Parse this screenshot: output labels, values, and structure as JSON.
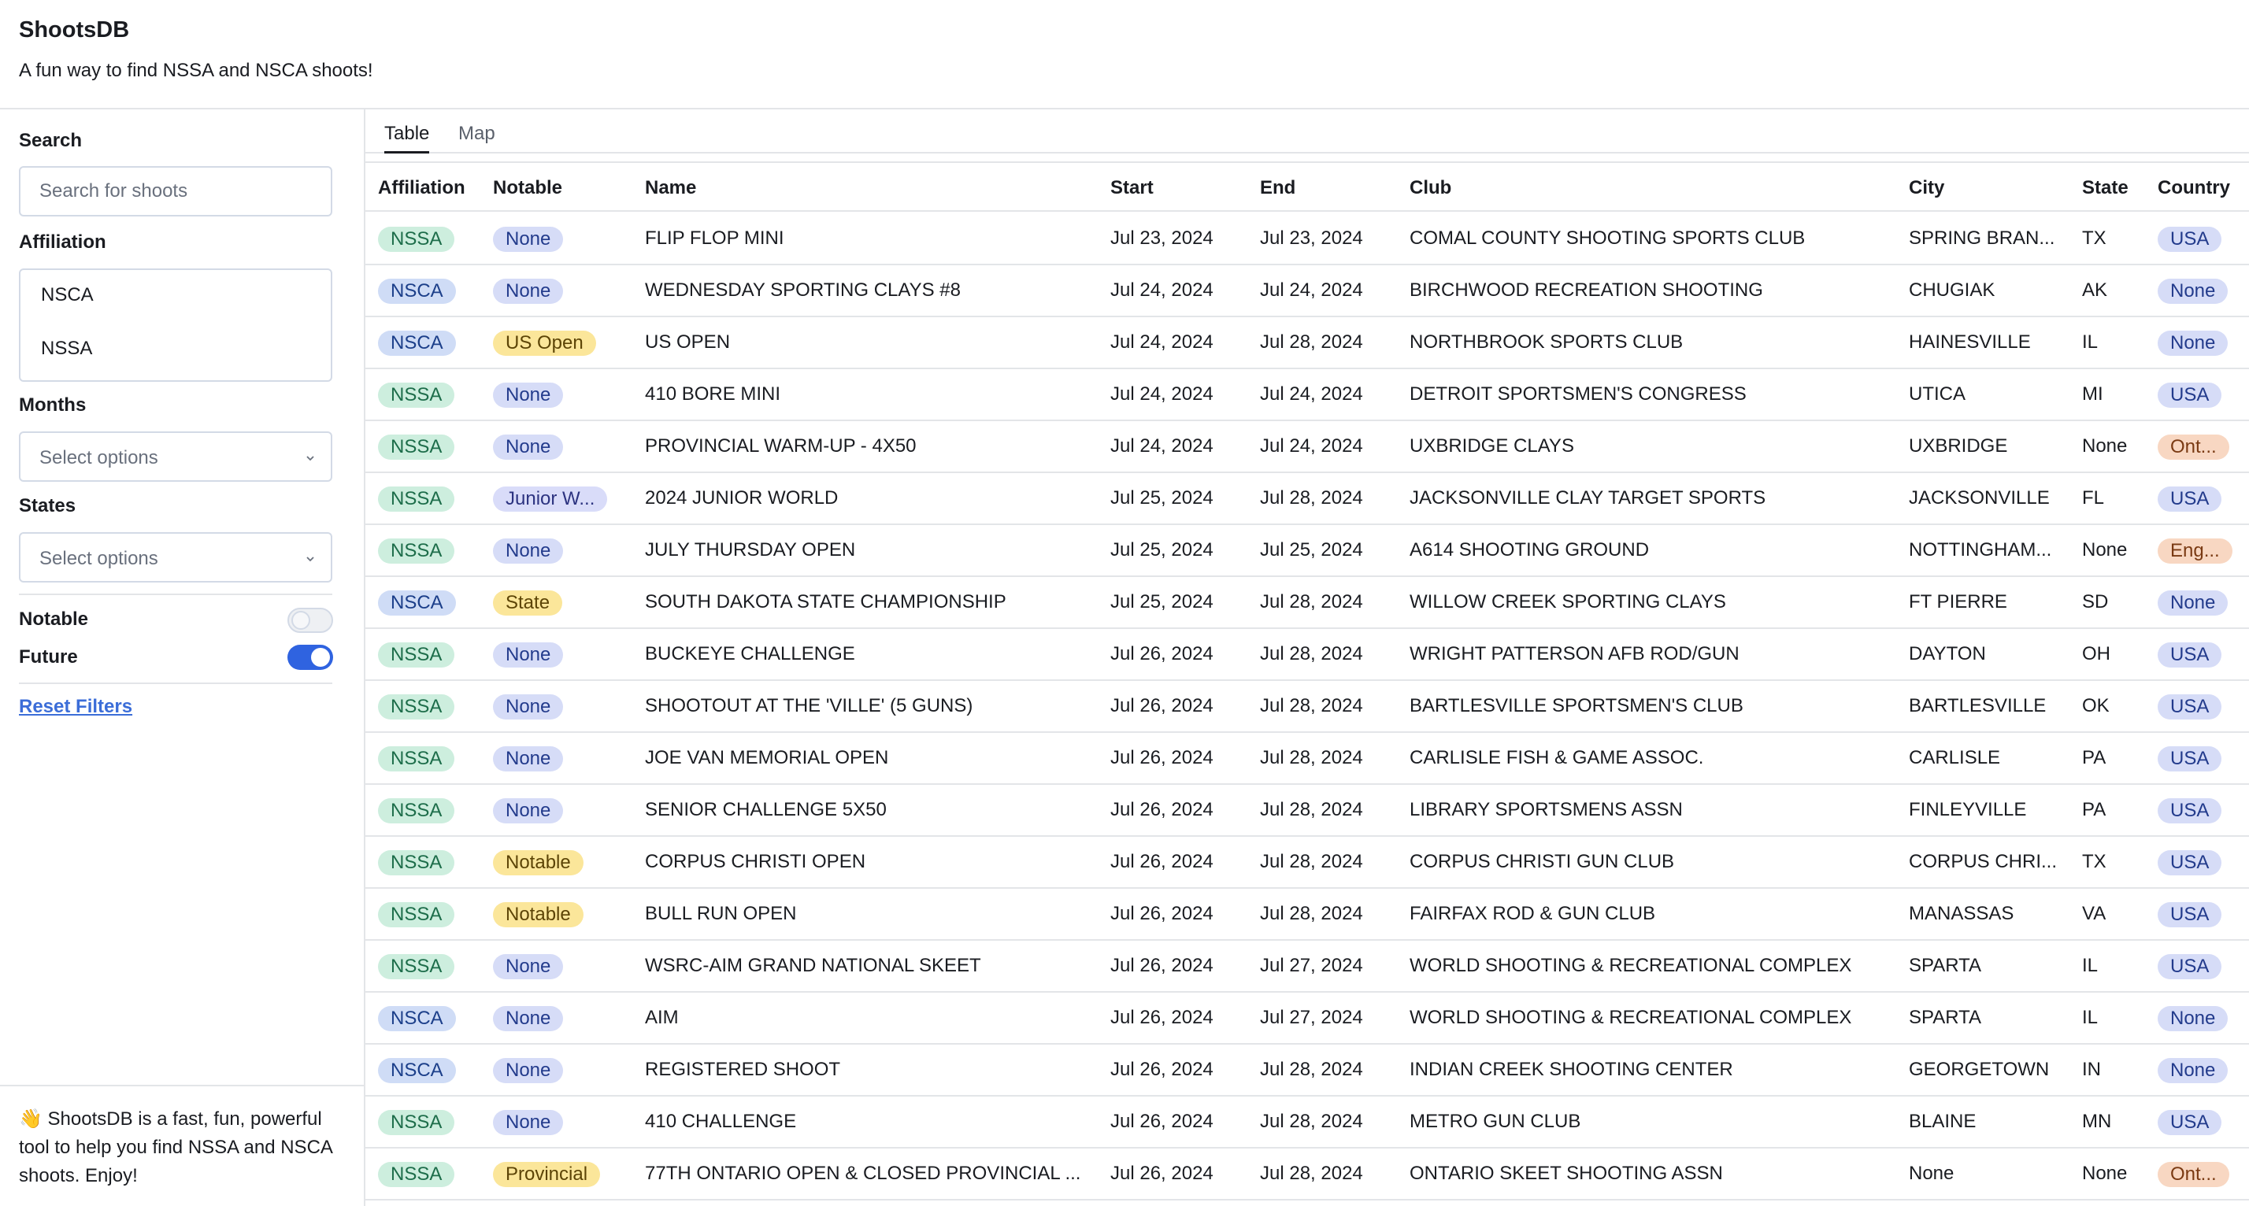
{
  "app": {
    "title": "ShootsDB",
    "subtitle": "A fun way to find NSSA and NSCA shoots!"
  },
  "sidebar": {
    "search_label": "Search",
    "search_placeholder": "Search for shoots",
    "affiliation_label": "Affiliation",
    "affiliation_options": [
      "NSCA",
      "NSSA"
    ],
    "months_label": "Months",
    "months_placeholder": "Select options",
    "states_label": "States",
    "states_placeholder": "Select options",
    "notable_label": "Notable",
    "notable_on": false,
    "future_label": "Future",
    "future_on": true,
    "reset_label": "Reset Filters",
    "footer_text": "👋 ShootsDB is a fast, fun, powerful tool to help you find NSSA and NSCA shoots. Enjoy!"
  },
  "tabs": [
    "Table",
    "Map"
  ],
  "active_tab": "Table",
  "table": {
    "columns": [
      "Affiliation",
      "Notable",
      "Name",
      "Start",
      "End",
      "Club",
      "City",
      "State",
      "Country"
    ],
    "rows": [
      [
        "NSSA",
        "None",
        "FLIP FLOP MINI",
        "Jul 23, 2024",
        "Jul 23, 2024",
        "COMAL COUNTY SHOOTING SPORTS CLUB",
        "SPRING BRAN...",
        "TX",
        "USA"
      ],
      [
        "NSCA",
        "None",
        "WEDNESDAY SPORTING CLAYS #8",
        "Jul 24, 2024",
        "Jul 24, 2024",
        "BIRCHWOOD RECREATION SHOOTING",
        "CHUGIAK",
        "AK",
        "None"
      ],
      [
        "NSCA",
        "US Open",
        "US OPEN",
        "Jul 24, 2024",
        "Jul 28, 2024",
        "NORTHBROOK SPORTS CLUB",
        "HAINESVILLE",
        "IL",
        "None"
      ],
      [
        "NSSA",
        "None",
        "410 BORE MINI",
        "Jul 24, 2024",
        "Jul 24, 2024",
        "DETROIT SPORTSMEN'S CONGRESS",
        "UTICA",
        "MI",
        "USA"
      ],
      [
        "NSSA",
        "None",
        "PROVINCIAL WARM-UP - 4X50",
        "Jul 24, 2024",
        "Jul 24, 2024",
        "UXBRIDGE CLAYS",
        "UXBRIDGE",
        "None",
        "Ont..."
      ],
      [
        "NSSA",
        "Junior W...",
        "2024 JUNIOR WORLD",
        "Jul 25, 2024",
        "Jul 28, 2024",
        "JACKSONVILLE CLAY TARGET SPORTS",
        "JACKSONVILLE",
        "FL",
        "USA"
      ],
      [
        "NSSA",
        "None",
        "JULY THURSDAY OPEN",
        "Jul 25, 2024",
        "Jul 25, 2024",
        "A614 SHOOTING GROUND",
        "NOTTINGHAM...",
        "None",
        "Eng..."
      ],
      [
        "NSCA",
        "State",
        "SOUTH DAKOTA STATE CHAMPIONSHIP",
        "Jul 25, 2024",
        "Jul 28, 2024",
        "WILLOW CREEK SPORTING CLAYS",
        "FT PIERRE",
        "SD",
        "None"
      ],
      [
        "NSSA",
        "None",
        "BUCKEYE CHALLENGE",
        "Jul 26, 2024",
        "Jul 28, 2024",
        "WRIGHT PATTERSON AFB ROD/GUN",
        "DAYTON",
        "OH",
        "USA"
      ],
      [
        "NSSA",
        "None",
        "SHOOTOUT AT THE 'VILLE' (5 GUNS)",
        "Jul 26, 2024",
        "Jul 28, 2024",
        "BARTLESVILLE SPORTSMEN'S CLUB",
        "BARTLESVILLE",
        "OK",
        "USA"
      ],
      [
        "NSSA",
        "None",
        "JOE VAN MEMORIAL OPEN",
        "Jul 26, 2024",
        "Jul 28, 2024",
        "CARLISLE FISH & GAME ASSOC.",
        "CARLISLE",
        "PA",
        "USA"
      ],
      [
        "NSSA",
        "None",
        "SENIOR CHALLENGE 5X50",
        "Jul 26, 2024",
        "Jul 28, 2024",
        "LIBRARY SPORTSMENS ASSN",
        "FINLEYVILLE",
        "PA",
        "USA"
      ],
      [
        "NSSA",
        "Notable",
        "CORPUS CHRISTI OPEN",
        "Jul 26, 2024",
        "Jul 28, 2024",
        "CORPUS CHRISTI GUN CLUB",
        "CORPUS CHRI...",
        "TX",
        "USA"
      ],
      [
        "NSSA",
        "Notable",
        "BULL RUN OPEN",
        "Jul 26, 2024",
        "Jul 28, 2024",
        "FAIRFAX ROD & GUN CLUB",
        "MANASSAS",
        "VA",
        "USA"
      ],
      [
        "NSSA",
        "None",
        "WSRC-AIM GRAND NATIONAL SKEET",
        "Jul 26, 2024",
        "Jul 27, 2024",
        "WORLD SHOOTING & RECREATIONAL COMPLEX",
        "SPARTA",
        "IL",
        "USA"
      ],
      [
        "NSCA",
        "None",
        "AIM",
        "Jul 26, 2024",
        "Jul 27, 2024",
        "WORLD SHOOTING & RECREATIONAL COMPLEX",
        "SPARTA",
        "IL",
        "None"
      ],
      [
        "NSCA",
        "None",
        "REGISTERED SHOOT",
        "Jul 26, 2024",
        "Jul 28, 2024",
        "INDIAN CREEK SHOOTING CENTER",
        "GEORGETOWN",
        "IN",
        "None"
      ],
      [
        "NSSA",
        "None",
        "410 CHALLENGE",
        "Jul 26, 2024",
        "Jul 28, 2024",
        "METRO GUN CLUB",
        "BLAINE",
        "MN",
        "USA"
      ],
      [
        "NSSA",
        "Provincial",
        "77TH ONTARIO OPEN & CLOSED PROVINCIAL ...",
        "Jul 26, 2024",
        "Jul 28, 2024",
        "ONTARIO SKEET SHOOTING ASSN",
        "None",
        "None",
        "Ont..."
      ]
    ]
  },
  "colors": {
    "nssa_badge": "#cdeede",
    "nsca_badge": "#cfdcf6",
    "none_badge": "#d6dcf7",
    "highlight_badge": "#fbe69a",
    "junior_badge": "#d9dcf9",
    "foreign_country_badge": "#f8d7c2",
    "accent": "#2f63e0"
  },
  "icons": {
    "select_chevron": "chevron-down-icon"
  }
}
